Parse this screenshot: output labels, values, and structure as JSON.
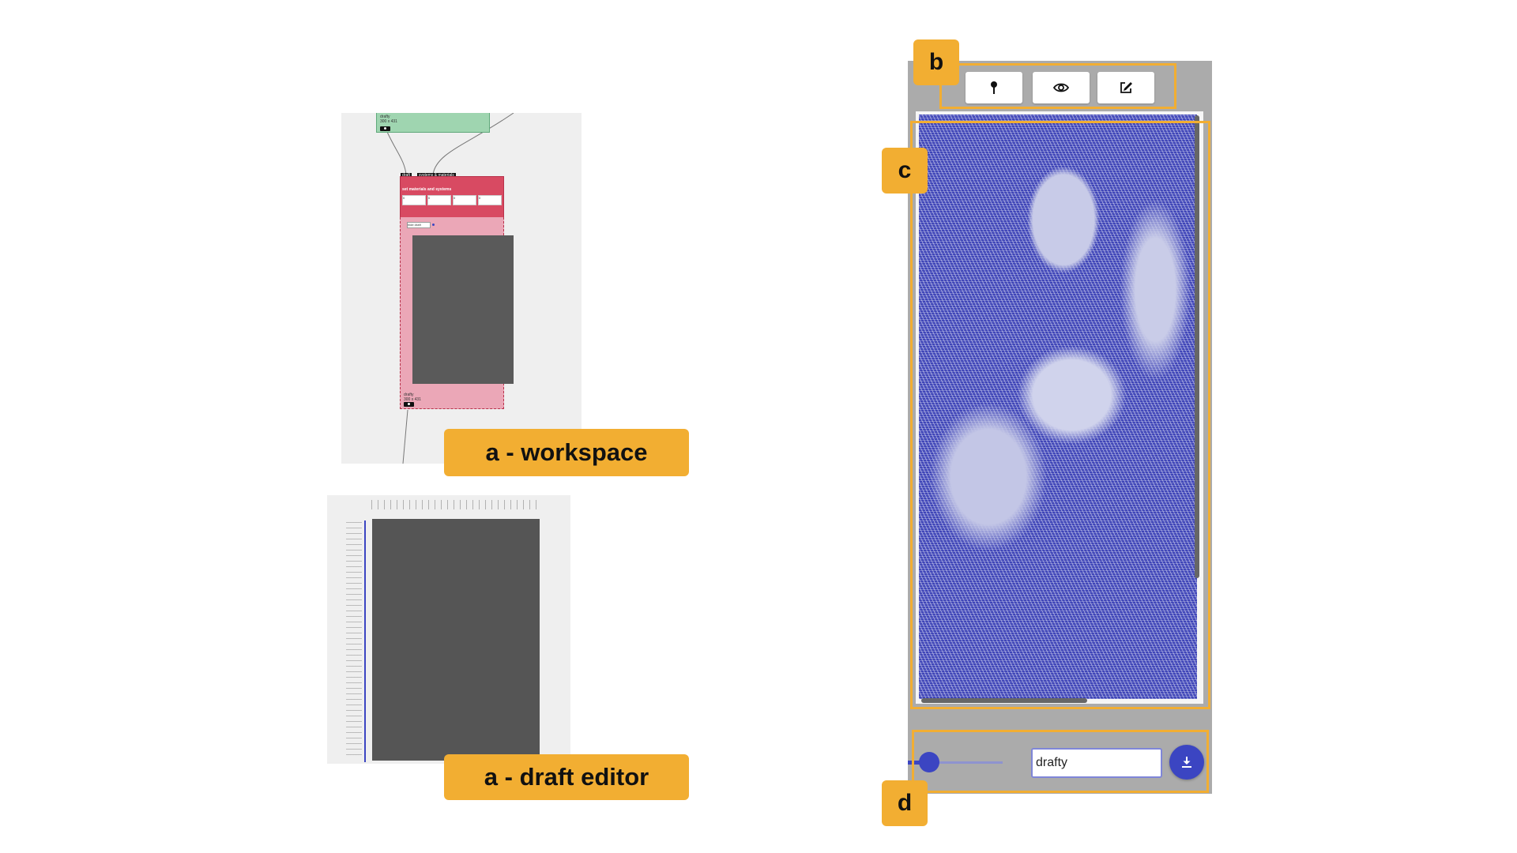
{
  "labels": {
    "workspace": "a - workspace",
    "draft_editor": "a - draft editor",
    "b": "b",
    "c": "c",
    "d": "d"
  },
  "workspace": {
    "green_node_label": "drafty\n300 x 431",
    "tag_draft": "draft",
    "tag_systems": "systems & materials",
    "red_node_title": "set materials and systems",
    "field_values": [
      "0",
      "0",
      "0",
      "0"
    ],
    "show_draft_label": "hide draft",
    "pink_node_label": "drafty\n300 x 431"
  },
  "toolbar": {
    "pin_icon": "pin-icon",
    "eye_icon": "eye-icon",
    "edit_icon": "edit-icon"
  },
  "footer": {
    "zoom_level": 0.2,
    "filename_value": "drafty",
    "download_icon": "download-icon"
  },
  "colors": {
    "accent": "#3b45c2",
    "label_orange": "#f2ae32",
    "panel_gray": "#ababab"
  }
}
